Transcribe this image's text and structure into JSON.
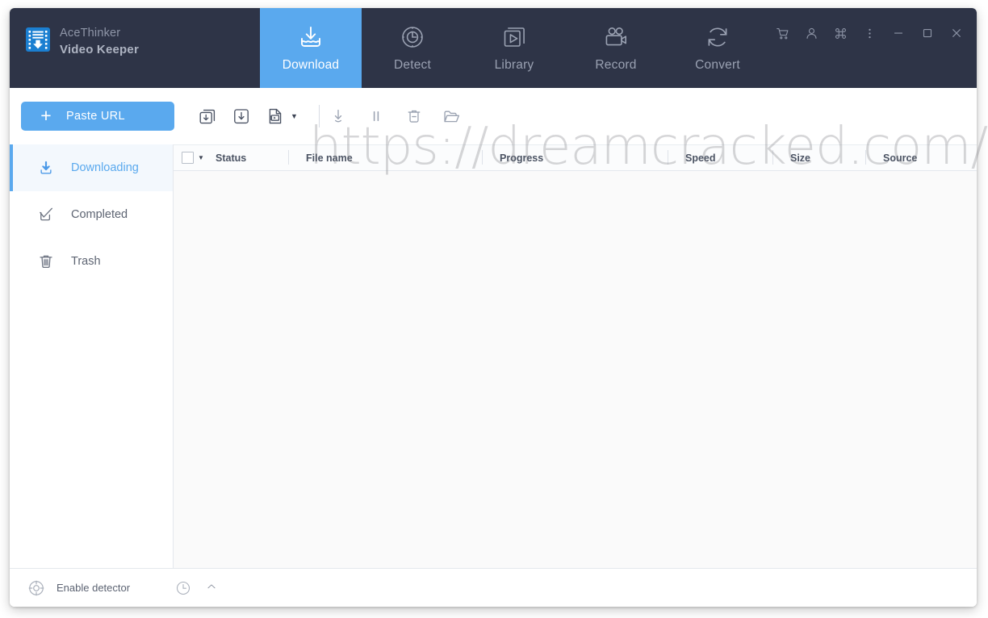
{
  "app": {
    "brand_name": "AceThinker",
    "product_name": "Video Keeper"
  },
  "nav": {
    "tabs": [
      {
        "label": "Download",
        "icon": "download-tray-icon",
        "active": true
      },
      {
        "label": "Detect",
        "icon": "radar-detect-icon",
        "active": false
      },
      {
        "label": "Library",
        "icon": "media-play-icon",
        "active": false
      },
      {
        "label": "Record",
        "icon": "video-camera-icon",
        "active": false
      },
      {
        "label": "Convert",
        "icon": "refresh-convert-icon",
        "active": false
      }
    ]
  },
  "window_controls": [
    {
      "name": "cart-icon",
      "tooltip": "Store"
    },
    {
      "name": "user-icon",
      "tooltip": "Account"
    },
    {
      "name": "command-icon",
      "tooltip": "Shortcuts"
    },
    {
      "name": "more-vert-icon",
      "tooltip": "Menu"
    },
    {
      "name": "minimize-icon",
      "tooltip": "Minimize"
    },
    {
      "name": "maximize-icon",
      "tooltip": "Maximize"
    },
    {
      "name": "close-icon",
      "tooltip": "Close"
    }
  ],
  "toolbar": {
    "paste_url_label": "Paste URL",
    "plus_glyph": "+",
    "buttons": [
      {
        "name": "batch-download-icon",
        "label": "Batch Download"
      },
      {
        "name": "single-download-icon",
        "label": "Download"
      },
      {
        "name": "video-format-icon",
        "label": "Video Format"
      },
      {
        "name": "format-caret-icon",
        "label": "More formats"
      },
      {
        "name": "start-download-icon",
        "label": "Start"
      },
      {
        "name": "pause-icon",
        "label": "Pause"
      },
      {
        "name": "delete-icon",
        "label": "Delete"
      },
      {
        "name": "open-folder-icon",
        "label": "Open folder"
      }
    ]
  },
  "sidebar": {
    "items": [
      {
        "label": "Downloading",
        "icon": "download-icon",
        "active": true
      },
      {
        "label": "Completed",
        "icon": "check-mark-icon",
        "active": false
      },
      {
        "label": "Trash",
        "icon": "trash-icon",
        "active": false
      }
    ]
  },
  "table": {
    "select_all_checked": false,
    "columns": [
      {
        "key": "status",
        "label": "Status"
      },
      {
        "key": "filename",
        "label": "File name"
      },
      {
        "key": "progress",
        "label": "Progress"
      },
      {
        "key": "speed",
        "label": "Speed"
      },
      {
        "key": "size",
        "label": "Size"
      },
      {
        "key": "source",
        "label": "Source"
      }
    ],
    "rows": []
  },
  "statusbar": {
    "detector_label": "Enable detector",
    "detector_icon": "crosshair-detector-icon",
    "clock_icon": "clock-icon",
    "expand_icon": "chevron-up-icon"
  },
  "watermark": {
    "text": "https://dreamcracked.com/"
  },
  "colors": {
    "header_bg": "#2e3447",
    "accent_blue": "#5aa9ee",
    "sidebar_active_bg": "#f3f8fd",
    "content_bg": "#fafafa",
    "border": "#e4e8ed"
  }
}
